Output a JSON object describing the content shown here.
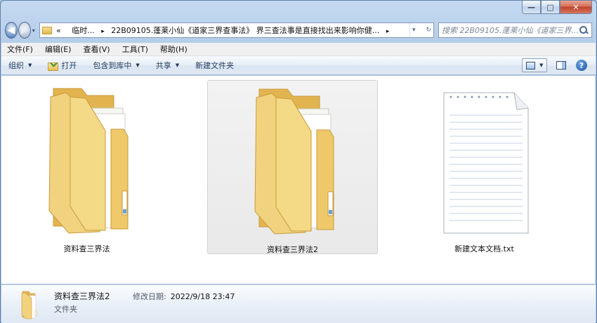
{
  "window": {
    "minimize_glyph": "—",
    "maximize_glyph": "□",
    "close_glyph": "✕"
  },
  "address_bar": {
    "overflow": "«",
    "crumbs": [
      "临时...",
      "22B09105.蓬莱小仙《道家三界查事法》 界三查法事是直接找出来影响你健..."
    ],
    "separator": "▸",
    "back_glyph": "◀",
    "forward_glyph": "▶",
    "dropdown_glyph": "▾",
    "refresh_glyph": "↻"
  },
  "search": {
    "placeholder": "搜索 22B09105.蓬莱小仙《道家三界..."
  },
  "menu": {
    "items": [
      "文件(F)",
      "编辑(E)",
      "查看(V)",
      "工具(T)",
      "帮助(H)"
    ]
  },
  "commands": {
    "organize": "组织",
    "open": "打开",
    "include_in_library": "包含到库中",
    "share": "共享",
    "new_folder": "新建文件夹",
    "dropdown_arrow": "▼",
    "help_glyph": "?"
  },
  "items": [
    {
      "label": "资料查三界法",
      "type": "folder",
      "selected": false
    },
    {
      "label": "资料查三界法2",
      "type": "folder",
      "selected": true
    },
    {
      "label": "新建文本文档.txt",
      "type": "text-file",
      "selected": false
    }
  ],
  "details": {
    "name": "资料查三界法2",
    "modified_label": "修改日期:",
    "modified_value": "2022/9/18 23:47",
    "type": "文件夹"
  },
  "colors": {
    "folder_front": "#f1d27e",
    "folder_back": "#e2b450",
    "selection": "#ececec",
    "command_text": "#1e395b"
  }
}
